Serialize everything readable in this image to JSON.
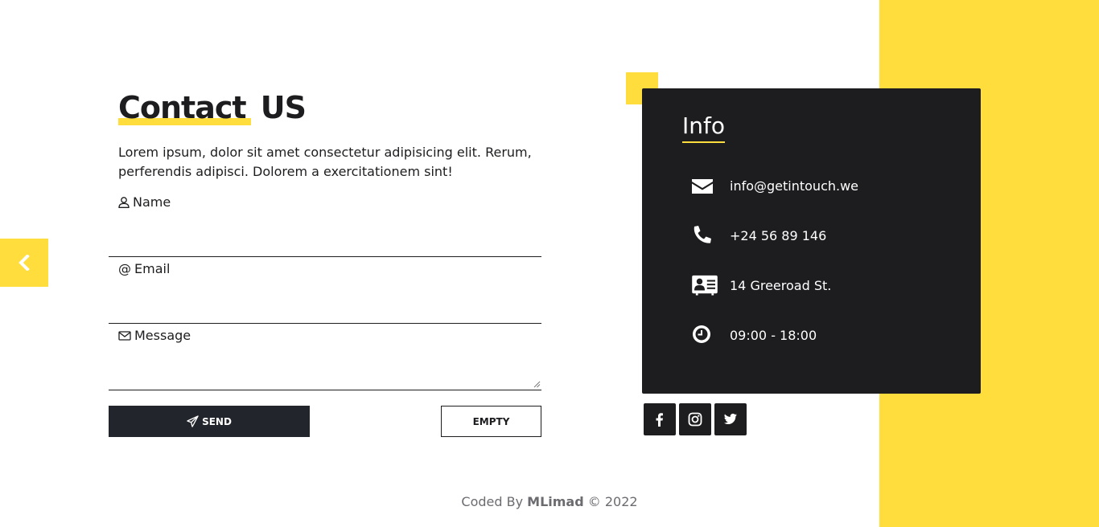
{
  "title": {
    "highlight": "Contact",
    "rest": "US"
  },
  "intro": "Lorem ipsum, dolor sit amet consectetur adipisicing elit. Rerum, perferendis adipisci. Dolorem a exercitationem sint!",
  "form": {
    "name_label": "Name",
    "name_value": "",
    "email_prefix": "@",
    "email_label": "Email",
    "email_value": "",
    "message_label": "Message",
    "message_value": ""
  },
  "buttons": {
    "send": "SEND",
    "empty": "EMPTY"
  },
  "info": {
    "title": "Info",
    "items": [
      {
        "icon": "envelope-icon",
        "text": "info@getintouch.we"
      },
      {
        "icon": "phone-icon",
        "text": "+24 56 89 146"
      },
      {
        "icon": "address-card-icon",
        "text": "14 Greeroad St."
      },
      {
        "icon": "clock-icon",
        "text": "09:00 - 18:00"
      }
    ]
  },
  "social": [
    "facebook-icon",
    "instagram-icon",
    "twitter-icon"
  ],
  "footer": {
    "prefix": "Coded By",
    "author": "MLimad",
    "suffix": "© 2022"
  },
  "colors": {
    "accent": "#ffdd3c",
    "dark": "#1d1d1f",
    "button_dark": "#22252b",
    "footer_text": "#6b6b70"
  }
}
